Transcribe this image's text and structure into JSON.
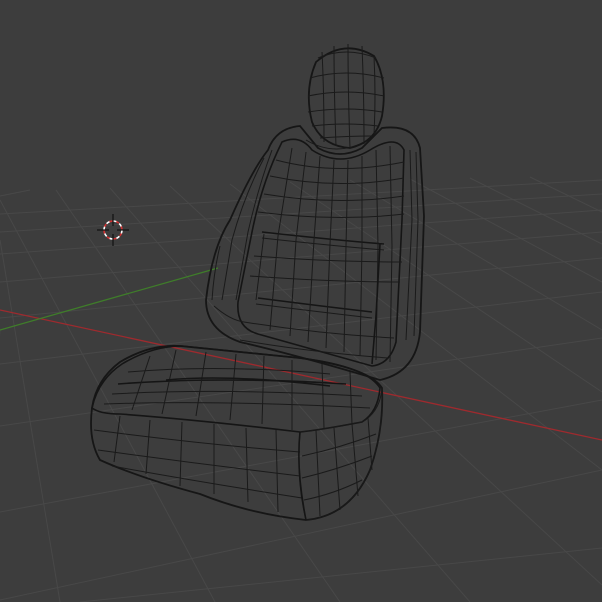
{
  "viewport": {
    "background": "#3d3d3d",
    "grid_color": "#484848",
    "x_axis_color": "#9e2a2e",
    "y_axis_color": "#3f7d2a",
    "mesh_fill": "#d2d4d8",
    "wire_color": "#1a1a1a"
  },
  "scene": {
    "object": "car-seat-mesh",
    "view_mode": "perspective",
    "shading": "solid-with-wireframe"
  },
  "icons": {
    "cursor": "3d-cursor-icon"
  }
}
